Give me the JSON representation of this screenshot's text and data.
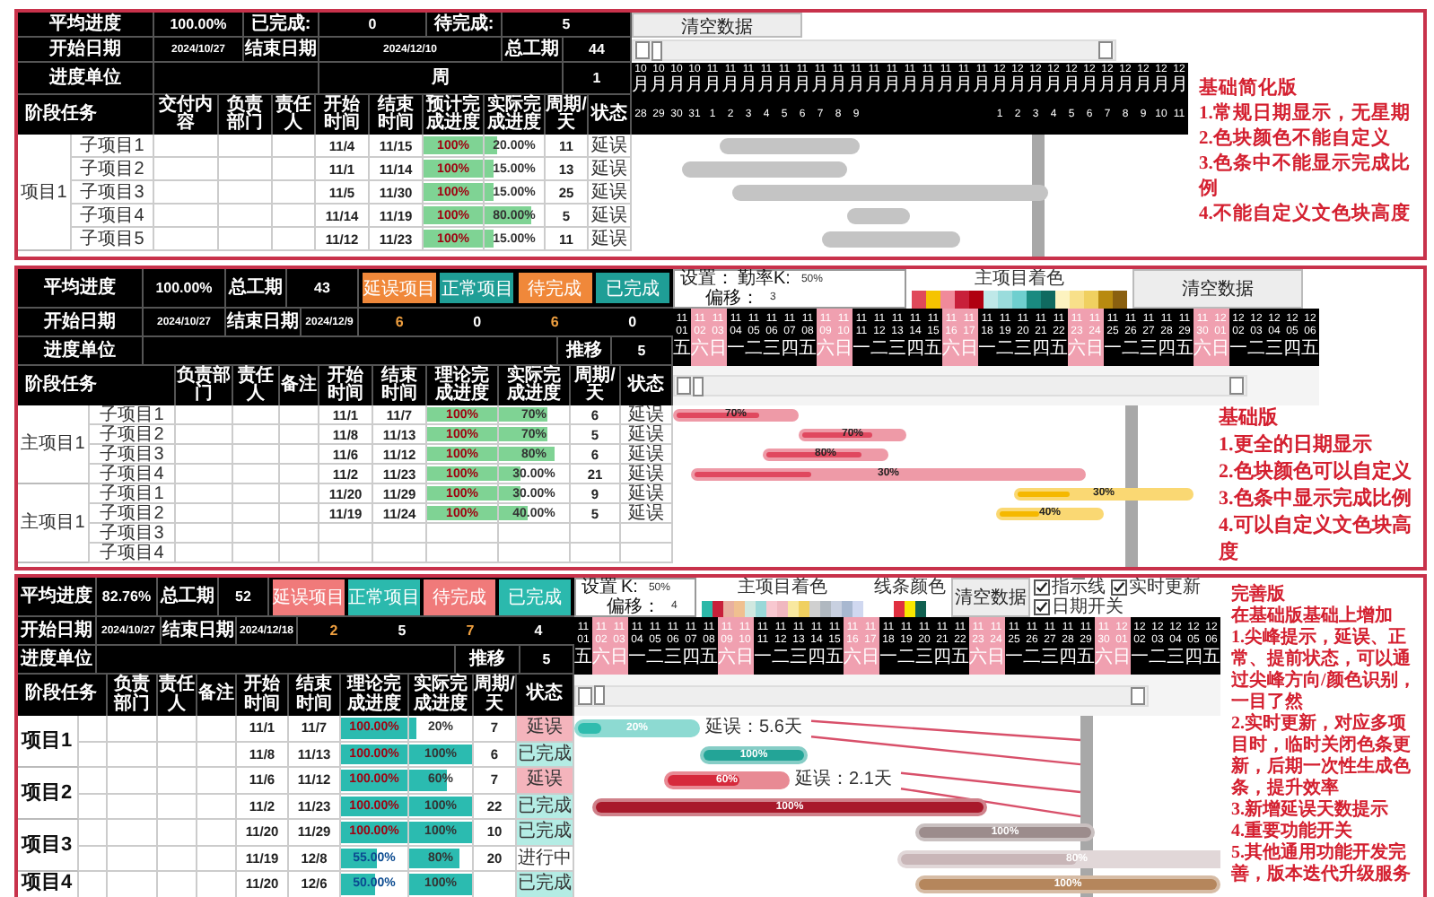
{
  "panels": [
    {
      "kind": "simple",
      "summary": [
        [
          "平均进度",
          "100.00%",
          "已完成:",
          "0",
          "待完成:",
          "5"
        ],
        [
          "开始日期",
          "2024/10/27",
          "结束日期",
          "2024/12/10",
          "总工期",
          "44"
        ],
        [
          "进度单位",
          "周",
          "1"
        ]
      ],
      "columns": [
        "阶段任务",
        "交付内容",
        "负责部门",
        "责任人",
        "开始时间",
        "结束时间",
        "预计完成进度",
        "实际完成进度",
        "周期/天",
        "状态"
      ],
      "groups": [
        {
          "label": "项目1",
          "rows": [
            {
              "name": "子项目1",
              "start": "11/4",
              "end": "11/15",
              "plan": {
                "text": "100%",
                "level": 1
              },
              "actual": {
                "text": "20.00%",
                "level": 0.2
              },
              "days": "11",
              "status": "延误",
              "bar": {
                "color": "#c4c4c4"
              }
            },
            {
              "name": "子项目2",
              "start": "11/1",
              "end": "11/14",
              "plan": {
                "text": "100%",
                "level": 1
              },
              "actual": {
                "text": "15.00%",
                "level": 0.15
              },
              "days": "13",
              "status": "延误",
              "bar": {
                "color": "#c4c4c4"
              }
            },
            {
              "name": "子项目3",
              "start": "11/5",
              "end": "11/30",
              "plan": {
                "text": "100%",
                "level": 1
              },
              "actual": {
                "text": "15.00%",
                "level": 0.15
              },
              "days": "25",
              "status": "延误",
              "bar": {
                "color": "#c4c4c4"
              }
            },
            {
              "name": "子项目4",
              "start": "11/14",
              "end": "11/19",
              "plan": {
                "text": "100%",
                "level": 1
              },
              "actual": {
                "text": "80.00%",
                "level": 0.8
              },
              "days": "5",
              "status": "延误",
              "bar": {
                "color": "#c4c4c4"
              }
            },
            {
              "name": "子项目5",
              "start": "11/12",
              "end": "11/23",
              "plan": {
                "text": "100%",
                "level": 1
              },
              "actual": {
                "text": "15.00%",
                "level": 0.15
              },
              "days": "11",
              "status": "延误",
              "bar": {
                "color": "#c4c4c4"
              }
            }
          ]
        }
      ],
      "gantt": {
        "clear_button": "清空数据",
        "columns": [
          {
            "month": "10",
            "unit": "月",
            "day": "28"
          },
          {
            "month": "10",
            "unit": "月",
            "day": "29"
          },
          {
            "month": "10",
            "unit": "月",
            "day": "30"
          },
          {
            "month": "10",
            "unit": "月",
            "day": "31"
          },
          {
            "month": "11",
            "unit": "月",
            "day": "1"
          },
          {
            "month": "11",
            "unit": "月",
            "day": "2"
          },
          {
            "month": "11",
            "unit": "月",
            "day": "3"
          },
          {
            "month": "11",
            "unit": "月",
            "day": "4"
          },
          {
            "month": "11",
            "unit": "月",
            "day": "5"
          },
          {
            "month": "11",
            "unit": "月",
            "day": "6"
          },
          {
            "month": "11",
            "unit": "月",
            "day": "7"
          },
          {
            "month": "11",
            "unit": "月",
            "day": "8"
          },
          {
            "month": "11",
            "unit": "月",
            "day": "9"
          },
          {
            "month": "11",
            "unit": "月"
          },
          {
            "month": "11",
            "unit": "月"
          },
          {
            "month": "11",
            "unit": "月"
          },
          {
            "month": "11",
            "unit": "月"
          },
          {
            "month": "11",
            "unit": "月"
          },
          {
            "month": "11",
            "unit": "月"
          },
          {
            "month": "11",
            "unit": "月"
          },
          {
            "month": "12",
            "unit": "月",
            "day": "1"
          },
          {
            "month": "12",
            "unit": "月",
            "day": "2"
          },
          {
            "month": "12",
            "unit": "月",
            "day": "3"
          },
          {
            "month": "12",
            "unit": "月",
            "day": "4"
          },
          {
            "month": "12",
            "unit": "月",
            "day": "5"
          },
          {
            "month": "12",
            "unit": "月",
            "day": "6"
          },
          {
            "month": "12",
            "unit": "月",
            "day": "7"
          },
          {
            "month": "12",
            "unit": "月",
            "day": "8"
          },
          {
            "month": "12",
            "unit": "月",
            "day": "9"
          },
          {
            "month": "12",
            "unit": "月",
            "day": "10"
          },
          {
            "month": "12",
            "unit": "月",
            "day": "11"
          }
        ]
      },
      "notes": [
        "基础简化版",
        "1.常规日期显示，无星期",
        "2.色块颜色不能自定义",
        "3.色条中不能显示完成比例",
        "4.不能自定义文色块高度"
      ]
    },
    {
      "kind": "basic",
      "summary": [
        [
          "平均进度",
          "100.00%",
          "总工期",
          "43"
        ],
        [
          "开始日期",
          "2024/10/27",
          "结束日期",
          "2024/12/9"
        ],
        [
          "进度单位",
          "推移",
          "5"
        ]
      ],
      "filters": [
        {
          "label": "延误项目",
          "count": "6",
          "kind": "delayed"
        },
        {
          "label": "正常项目",
          "count": "0",
          "kind": "normal"
        },
        {
          "label": "待完成",
          "count": "6",
          "kind": "pending"
        },
        {
          "label": "已完成",
          "count": "0",
          "kind": "done"
        }
      ],
      "columns": [
        "阶段任务",
        "负责部门",
        "责任人",
        "备注",
        "开始时间",
        "结束时间",
        "理论完成进度",
        "实际完成进度",
        "周期/天",
        "状态"
      ],
      "groups": [
        {
          "label": "主项目1",
          "rows": [
            {
              "name": "子项目1",
              "start": "11/1",
              "end": "11/7",
              "plan": {
                "text": "100%",
                "level": 1
              },
              "actual": {
                "text": "70%",
                "level": 0.7
              },
              "days": "6",
              "status": "延误",
              "bar": {
                "color": "#e0485f",
                "level": 0.7,
                "label": "70%"
              }
            },
            {
              "name": "子项目2",
              "start": "11/8",
              "end": "11/13",
              "plan": {
                "text": "100%",
                "level": 1
              },
              "actual": {
                "text": "70%",
                "level": 0.7
              },
              "days": "5",
              "status": "延误",
              "bar": {
                "color": "#e0485f",
                "level": 0.7,
                "label": "70%"
              }
            },
            {
              "name": "子项目3",
              "start": "11/6",
              "end": "11/12",
              "plan": {
                "text": "100%",
                "level": 1
              },
              "actual": {
                "text": "80%",
                "level": 0.8
              },
              "days": "6",
              "status": "延误",
              "bar": {
                "color": "#e0485f",
                "level": 0.8,
                "label": "80%"
              }
            },
            {
              "name": "子项目4",
              "start": "11/2",
              "end": "11/23",
              "plan": {
                "text": "100%",
                "level": 1
              },
              "actual": {
                "text": "30.00%",
                "level": 0.3
              },
              "days": "21",
              "status": "延误",
              "bar": {
                "color": "#e0485f",
                "level": 0.3,
                "label": "30%"
              }
            }
          ]
        },
        {
          "label": "主项目1",
          "rows": [
            {
              "name": "子项目1",
              "start": "11/20",
              "end": "11/29",
              "plan": {
                "text": "100%",
                "level": 1
              },
              "actual": {
                "text": "30.00%",
                "level": 0.3
              },
              "days": "9",
              "status": "延误",
              "bar": {
                "color": "#f5b800",
                "level": 0.3,
                "label": "30%"
              }
            },
            {
              "name": "子项目2",
              "start": "11/19",
              "end": "11/24",
              "plan": {
                "text": "100%",
                "level": 1
              },
              "actual": {
                "text": "40.00%",
                "level": 0.4
              },
              "days": "5",
              "status": "延误",
              "bar": {
                "color": "#f5b800",
                "level": 0.4,
                "label": "40%"
              }
            },
            {
              "name": "子项目3"
            },
            {
              "name": "子项目4"
            }
          ]
        }
      ],
      "gantt": {
        "clear_button": "清空数据",
        "settings": {
          "title": "设置：",
          "rows": [
            {
              "label": "勤率K:",
              "value": "50%"
            },
            {
              "label": "偏移：",
              "value": "3"
            }
          ]
        },
        "palettes": [
          {
            "label": "主项目着色",
            "colors": [
              {
                "color": "#e04a5a"
              },
              {
                "color": "#f5c400"
              },
              {
                "color": "#f08a9a"
              },
              {
                "color": "#c8203a"
              },
              {
                "color": "#b00010"
              },
              {
                "color": "#bfe8e8"
              },
              {
                "color": "#9adcdc"
              },
              {
                "color": "#6fcfcf"
              },
              {
                "color": "#1a8a80"
              },
              {
                "color": "#106a60"
              },
              {
                "color": "#fdf3c0"
              },
              {
                "color": "#f8e08a"
              },
              {
                "color": "#f0d060"
              },
              {
                "color": "#b88a10"
              },
              {
                "color": "#8a6010"
              }
            ]
          }
        ],
        "columns": [
          {
            "month": "11",
            "day": "01",
            "weekday": "五",
            "weekend": false
          },
          {
            "month": "11",
            "day": "02",
            "weekday": "六",
            "weekend": true
          },
          {
            "month": "11",
            "day": "03",
            "weekday": "日",
            "weekend": true
          },
          {
            "month": "11",
            "day": "04",
            "weekday": "一",
            "weekend": false
          },
          {
            "month": "11",
            "day": "05",
            "weekday": "二",
            "weekend": false
          },
          {
            "month": "11",
            "day": "06",
            "weekday": "三",
            "weekend": false
          },
          {
            "month": "11",
            "day": "07",
            "weekday": "四",
            "weekend": false
          },
          {
            "month": "11",
            "day": "08",
            "weekday": "五",
            "weekend": false
          },
          {
            "month": "11",
            "day": "09",
            "weekday": "六",
            "weekend": true
          },
          {
            "month": "11",
            "day": "10",
            "weekday": "日",
            "weekend": true
          },
          {
            "month": "11",
            "day": "11",
            "weekday": "一",
            "weekend": false
          },
          {
            "month": "11",
            "day": "12",
            "weekday": "二",
            "weekend": false
          },
          {
            "month": "11",
            "day": "13",
            "weekday": "三",
            "weekend": false
          },
          {
            "month": "11",
            "day": "14",
            "weekday": "四",
            "weekend": false
          },
          {
            "month": "11",
            "day": "15",
            "weekday": "五",
            "weekend": false
          },
          {
            "month": "11",
            "day": "16",
            "weekday": "六",
            "weekend": true
          },
          {
            "month": "11",
            "day": "17",
            "weekday": "日",
            "weekend": true
          },
          {
            "month": "11",
            "day": "18",
            "weekday": "一",
            "weekend": false
          },
          {
            "month": "11",
            "day": "19",
            "weekday": "二",
            "weekend": false
          },
          {
            "month": "11",
            "day": "20",
            "weekday": "三",
            "weekend": false
          },
          {
            "month": "11",
            "day": "21",
            "weekday": "四",
            "weekend": false
          },
          {
            "month": "11",
            "day": "22",
            "weekday": "五",
            "weekend": false
          },
          {
            "month": "11",
            "day": "23",
            "weekday": "六",
            "weekend": true
          },
          {
            "month": "11",
            "day": "24",
            "weekday": "日",
            "weekend": true
          },
          {
            "month": "11",
            "day": "25",
            "weekday": "一",
            "weekend": false
          },
          {
            "month": "11",
            "day": "26",
            "weekday": "二",
            "weekend": false
          },
          {
            "month": "11",
            "day": "27",
            "weekday": "三",
            "weekend": false
          },
          {
            "month": "11",
            "day": "28",
            "weekday": "四",
            "weekend": false
          },
          {
            "month": "11",
            "day": "29",
            "weekday": "五",
            "weekend": false
          },
          {
            "month": "11",
            "day": "30",
            "weekday": "六",
            "weekend": true
          },
          {
            "month": "12",
            "day": "01",
            "weekday": "日",
            "weekend": true
          },
          {
            "month": "12",
            "day": "02",
            "weekday": "一",
            "weekend": false
          },
          {
            "month": "12",
            "day": "03",
            "weekday": "二",
            "weekend": false
          },
          {
            "month": "12",
            "day": "04",
            "weekday": "三",
            "weekend": false
          },
          {
            "month": "12",
            "day": "05",
            "weekday": "四",
            "weekend": false
          },
          {
            "month": "12",
            "day": "06",
            "weekday": "五",
            "weekend": false
          }
        ]
      },
      "notes": [
        "基础版",
        "1.更全的日期显示",
        "2.色块颜色可以自定义",
        "3.色条中显示完成比例",
        "4.可以自定义文色块高度"
      ]
    },
    {
      "kind": "full",
      "summary": [
        [
          "平均进度",
          "82.76%",
          "总工期",
          "52"
        ],
        [
          "开始日期",
          "2024/10/27",
          "结束日期",
          "2024/12/18"
        ],
        [
          "进度单位",
          "推移",
          "5"
        ]
      ],
      "filters": [
        {
          "label": "延误项目",
          "count": "2",
          "kind": "delayed"
        },
        {
          "label": "正常项目",
          "count": "5",
          "kind": "normal"
        },
        {
          "label": "待完成",
          "count": "7",
          "kind": "pending"
        },
        {
          "label": "已完成",
          "count": "4",
          "kind": "done"
        }
      ],
      "columns": [
        "阶段任务",
        "负责部门",
        "责任人",
        "备注",
        "开始时间",
        "结束时间",
        "理论完成进度",
        "实际完成进度",
        "周期/天",
        "状态"
      ],
      "groups": [
        {
          "label": "项目1",
          "rows": [
            {
              "start": "11/1",
              "end": "11/7",
              "plan": {
                "text": "100.00%",
                "level": 1
              },
              "actual": {
                "text": "20%",
                "level": 0.1
              },
              "days": "7",
              "status": {
                "text": "延误",
                "kind": "delayed"
              },
              "bar": {
                "color": "#2fbcae",
                "level": 0.2,
                "label": "20%"
              },
              "delay": "延误：5.6天"
            },
            {
              "start": "11/8",
              "end": "11/13",
              "plan": {
                "text": "100.00%",
                "level": 1
              },
              "actual": {
                "text": "100%",
                "level": 1
              },
              "days": "6",
              "status": {
                "text": "已完成",
                "kind": "done"
              },
              "bar": {
                "color": "#23a497",
                "level": 1,
                "label": "100%"
              }
            }
          ]
        },
        {
          "label": "项目2",
          "rows": [
            {
              "start": "11/6",
              "end": "11/12",
              "plan": {
                "text": "100.00%",
                "level": 1
              },
              "actual": {
                "text": "60%",
                "level": 0.6
              },
              "days": "7",
              "status": {
                "text": "延误",
                "kind": "delayed"
              },
              "bar": {
                "color": "#d62a3c",
                "level": 0.6,
                "label": "60%"
              },
              "delay": "延误：2.1天"
            },
            {
              "start": "11/2",
              "end": "11/23",
              "plan": {
                "text": "100.00%",
                "level": 1
              },
              "actual": {
                "text": "100%",
                "level": 1
              },
              "days": "22",
              "status": {
                "text": "已完成",
                "kind": "done"
              },
              "bar": {
                "color": "#a8192b",
                "level": 1,
                "label": "100%"
              }
            }
          ]
        },
        {
          "label": "项目3",
          "rows": [
            {
              "start": "11/20",
              "end": "11/29",
              "plan": {
                "text": "100.00%",
                "level": 1
              },
              "actual": {
                "text": "100%",
                "level": 1
              },
              "days": "10",
              "status": {
                "text": "已完成",
                "kind": "done"
              },
              "bar": {
                "color": "#9c8c8c",
                "level": 1,
                "label": "100%"
              }
            },
            {
              "start": "11/19",
              "end": "12/8",
              "plan": {
                "text": "55.00%",
                "level": 0.55
              },
              "actual": {
                "text": "80%",
                "level": 0.8
              },
              "days": "20",
              "status": {
                "text": "进行中",
                "kind": "ongoing"
              },
              "bar": {
                "color": "#c9b6b8",
                "level": 0.5,
                "label": "80%"
              }
            }
          ]
        },
        {
          "label": "项目4",
          "rows": [
            {
              "start": "11/20",
              "end": "12/6",
              "plan": {
                "text": "50.00%",
                "level": 0.5
              },
              "actual": {
                "text": "100%",
                "level": 1
              },
              "status": {
                "text": "已完成",
                "kind": "done"
              },
              "bar": {
                "color": "#b5865c",
                "level": 1,
                "label": "100%"
              }
            }
          ]
        }
      ],
      "gantt": {
        "clear_button": "清空数据",
        "settings": {
          "title": "设置",
          "rows": [
            {
              "label": "K:",
              "value": "50%"
            },
            {
              "label": "偏移：",
              "value": "4"
            }
          ]
        },
        "palettes": [
          {
            "label": "主项目着色",
            "colors": [
              {
                "color": "#2bb8a8"
              },
              {
                "color": "#c8203a"
              },
              {
                "color": "#e8b0a0"
              },
              {
                "color": "#f0c090"
              },
              {
                "color": "#d0e8e0"
              },
              {
                "color": "#9ad8d8"
              },
              {
                "color": "#f8c8d0"
              },
              {
                "color": "#f0b8c0"
              },
              {
                "color": "#f8e8a0"
              },
              {
                "color": "#f0d060"
              },
              {
                "color": "#d0d0d0"
              },
              {
                "color": "#b0b8c0"
              },
              {
                "color": "#c8d0e0"
              },
              {
                "color": "#a8b8d0"
              },
              {
                "color": "#d0d8f0"
              }
            ]
          },
          {
            "label": "线条颜色",
            "colors": [
              {
                "color": "#e03040"
              },
              {
                "color": "#f8e800"
              },
              {
                "color": "#106050"
              }
            ]
          }
        ],
        "checkboxes": [
          {
            "label": "指示线",
            "checked": true
          },
          {
            "label": "实时更新",
            "checked": true
          },
          {
            "label": "日期开关",
            "checked": true
          }
        ],
        "columns": [
          {
            "month": "11",
            "day": "01",
            "weekday": "五",
            "weekend": false
          },
          {
            "month": "11",
            "day": "02",
            "weekday": "六",
            "weekend": true
          },
          {
            "month": "11",
            "day": "03",
            "weekday": "日",
            "weekend": true
          },
          {
            "month": "11",
            "day": "04",
            "weekday": "一",
            "weekend": false
          },
          {
            "month": "11",
            "day": "05",
            "weekday": "二",
            "weekend": false
          },
          {
            "month": "11",
            "day": "06",
            "weekday": "三",
            "weekend": false
          },
          {
            "month": "11",
            "day": "07",
            "weekday": "四",
            "weekend": false
          },
          {
            "month": "11",
            "day": "08",
            "weekday": "五",
            "weekend": false
          },
          {
            "month": "11",
            "day": "09",
            "weekday": "六",
            "weekend": true
          },
          {
            "month": "11",
            "day": "10",
            "weekday": "日",
            "weekend": true
          },
          {
            "month": "11",
            "day": "11",
            "weekday": "一",
            "weekend": false
          },
          {
            "month": "11",
            "day": "12",
            "weekday": "二",
            "weekend": false
          },
          {
            "month": "11",
            "day": "13",
            "weekday": "三",
            "weekend": false
          },
          {
            "month": "11",
            "day": "14",
            "weekday": "四",
            "weekend": false
          },
          {
            "month": "11",
            "day": "15",
            "weekday": "五",
            "weekend": false
          },
          {
            "month": "11",
            "day": "16",
            "weekday": "六",
            "weekend": true
          },
          {
            "month": "11",
            "day": "17",
            "weekday": "日",
            "weekend": true
          },
          {
            "month": "11",
            "day": "18",
            "weekday": "一",
            "weekend": false
          },
          {
            "month": "11",
            "day": "19",
            "weekday": "二",
            "weekend": false
          },
          {
            "month": "11",
            "day": "20",
            "weekday": "三",
            "weekend": false
          },
          {
            "month": "11",
            "day": "21",
            "weekday": "四",
            "weekend": false
          },
          {
            "month": "11",
            "day": "22",
            "weekday": "五",
            "weekend": false
          },
          {
            "month": "11",
            "day": "23",
            "weekday": "六",
            "weekend": true
          },
          {
            "month": "11",
            "day": "24",
            "weekday": "日",
            "weekend": true
          },
          {
            "month": "11",
            "day": "25",
            "weekday": "一",
            "weekend": false
          },
          {
            "month": "11",
            "day": "26",
            "weekday": "二",
            "weekend": false
          },
          {
            "month": "11",
            "day": "27",
            "weekday": "三",
            "weekend": false
          },
          {
            "month": "11",
            "day": "28",
            "weekday": "四",
            "weekend": false
          },
          {
            "month": "11",
            "day": "29",
            "weekday": "五",
            "weekend": false
          },
          {
            "month": "11",
            "day": "30",
            "weekday": "六",
            "weekend": true
          },
          {
            "month": "12",
            "day": "01",
            "weekday": "日",
            "weekend": true
          },
          {
            "month": "12",
            "day": "02",
            "weekday": "一",
            "weekend": false
          },
          {
            "month": "12",
            "day": "03",
            "weekday": "二",
            "weekend": false
          },
          {
            "month": "12",
            "day": "04",
            "weekday": "三",
            "weekend": false
          },
          {
            "month": "12",
            "day": "05",
            "weekday": "四",
            "weekend": false
          },
          {
            "month": "12",
            "day": "06",
            "weekday": "五",
            "weekend": false
          }
        ]
      },
      "notes": [
        "完善版",
        "在基础版基础上增加",
        "1.尖峰提示，延误、正常、提前状态，可以通过尖峰方向/颜色识别，一目了然",
        "2.实时更新，对应多项目时，临时关闭色条更新，后期一次性生成色条，提升效率",
        "3.新增延误天数提示",
        "4.重要功能开关",
        "5.其他通用功能开发完善，版本迭代升级服务"
      ]
    }
  ]
}
